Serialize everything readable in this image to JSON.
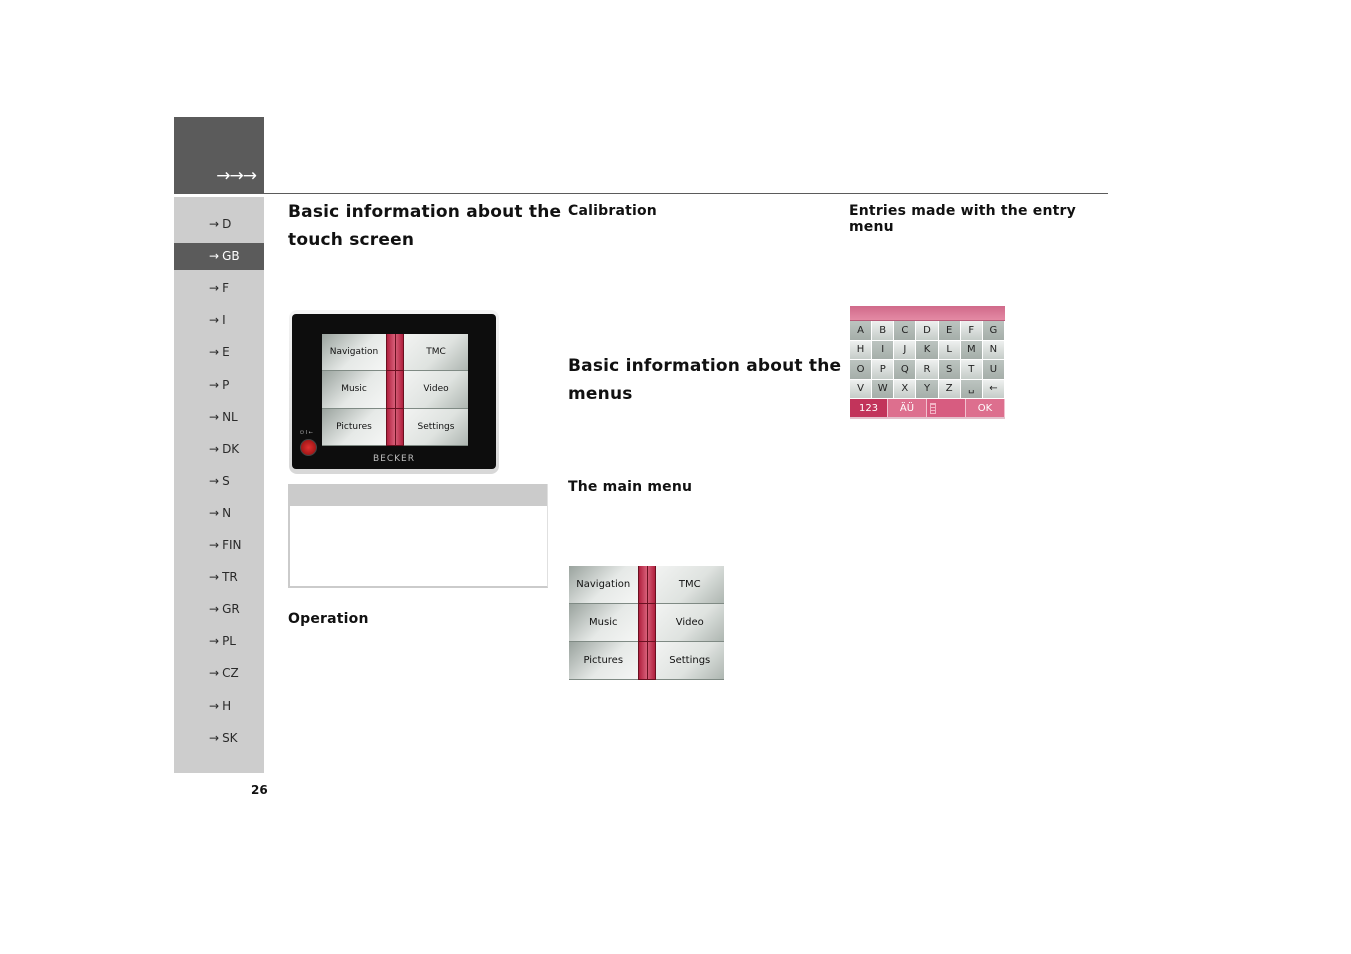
{
  "header": {
    "arrows": "→→→"
  },
  "sidebar": {
    "arrow": "→",
    "items": [
      {
        "label": "D",
        "active": false
      },
      {
        "label": "GB",
        "active": true
      },
      {
        "label": "F",
        "active": false
      },
      {
        "label": "I",
        "active": false
      },
      {
        "label": "E",
        "active": false
      },
      {
        "label": "P",
        "active": false
      },
      {
        "label": "NL",
        "active": false
      },
      {
        "label": "DK",
        "active": false
      },
      {
        "label": "S",
        "active": false
      },
      {
        "label": "N",
        "active": false
      },
      {
        "label": "FIN",
        "active": false
      },
      {
        "label": "TR",
        "active": false
      },
      {
        "label": "GR",
        "active": false
      },
      {
        "label": "PL",
        "active": false
      },
      {
        "label": "CZ",
        "active": false
      },
      {
        "label": "H",
        "active": false
      },
      {
        "label": "SK",
        "active": false
      }
    ]
  },
  "page_number": "26",
  "column1": {
    "heading_line1": "Basic information about the",
    "heading_line2": "touch screen",
    "operation_heading": "Operation"
  },
  "column2": {
    "calibration_heading": "Calibration",
    "menus_heading_line1": "Basic information about the",
    "menus_heading_line2": "menus",
    "main_menu_heading": "The main menu"
  },
  "column3": {
    "entry_heading_line1": "Entries made with the entry",
    "entry_heading_line2": "menu"
  },
  "device": {
    "brand": "BECKER",
    "button_label": "⏻ I ←"
  },
  "main_menu": {
    "items": [
      "Navigation",
      "TMC",
      "Music",
      "Video",
      "Pictures",
      "Settings"
    ]
  },
  "keyboard": {
    "rows": [
      [
        "A",
        "B",
        "C",
        "D",
        "E",
        "F",
        "G"
      ],
      [
        "H",
        "I",
        "J",
        "K",
        "L",
        "M",
        "N"
      ],
      [
        "O",
        "P",
        "Q",
        "R",
        "S",
        "T",
        "U"
      ],
      [
        "V",
        "W",
        "X",
        "Y",
        "Z",
        "␣",
        "←"
      ]
    ],
    "bottom": {
      "numbers": "123",
      "umlauts": "ÄÜ",
      "ok": "OK"
    }
  },
  "colors": {
    "header_gray": "#5b5b5b",
    "sidebar_gray": "#cdcdcd",
    "accent_red": "#c2345b"
  }
}
